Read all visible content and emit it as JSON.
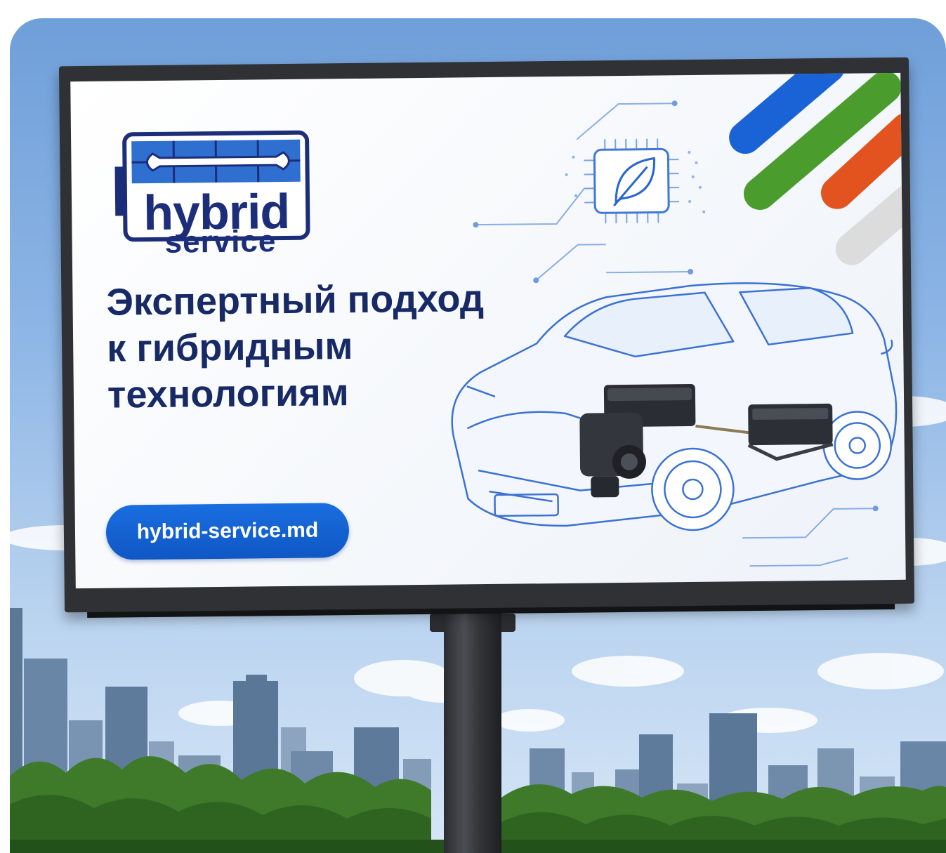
{
  "billboard": {
    "logo": {
      "wordmark": "hybrid",
      "subtitle": "service"
    },
    "headline": {
      "line1": "Экспертный подход",
      "line2": "к гибридным",
      "line3": "технологиям"
    },
    "cta": {
      "label": "hybrid-service.md"
    },
    "stripes": {
      "colors": [
        "#1a63d6",
        "#4a9d2c",
        "#e2531f",
        "#dcdcdc"
      ]
    },
    "chip_icon": "leaf-icon",
    "illustration": "hybrid-car-sketch"
  },
  "colors": {
    "brand_navy": "#182a66",
    "brand_blue": "#1a6ee0",
    "logo_blue": "#2f6fd0"
  }
}
